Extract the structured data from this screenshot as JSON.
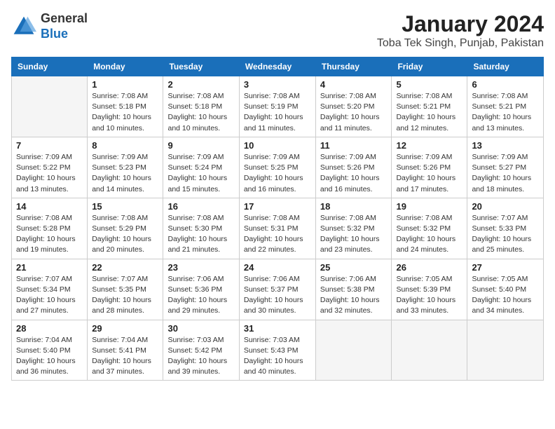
{
  "header": {
    "logo_line1": "General",
    "logo_line2": "Blue",
    "month_title": "January 2024",
    "location": "Toba Tek Singh, Punjab, Pakistan"
  },
  "weekdays": [
    "Sunday",
    "Monday",
    "Tuesday",
    "Wednesday",
    "Thursday",
    "Friday",
    "Saturday"
  ],
  "weeks": [
    [
      {
        "day": "",
        "info": ""
      },
      {
        "day": "1",
        "info": "Sunrise: 7:08 AM\nSunset: 5:18 PM\nDaylight: 10 hours\nand 10 minutes."
      },
      {
        "day": "2",
        "info": "Sunrise: 7:08 AM\nSunset: 5:18 PM\nDaylight: 10 hours\nand 10 minutes."
      },
      {
        "day": "3",
        "info": "Sunrise: 7:08 AM\nSunset: 5:19 PM\nDaylight: 10 hours\nand 11 minutes."
      },
      {
        "day": "4",
        "info": "Sunrise: 7:08 AM\nSunset: 5:20 PM\nDaylight: 10 hours\nand 11 minutes."
      },
      {
        "day": "5",
        "info": "Sunrise: 7:08 AM\nSunset: 5:21 PM\nDaylight: 10 hours\nand 12 minutes."
      },
      {
        "day": "6",
        "info": "Sunrise: 7:08 AM\nSunset: 5:21 PM\nDaylight: 10 hours\nand 13 minutes."
      }
    ],
    [
      {
        "day": "7",
        "info": ""
      },
      {
        "day": "8",
        "info": "Sunrise: 7:09 AM\nSunset: 5:23 PM\nDaylight: 10 hours\nand 14 minutes."
      },
      {
        "day": "9",
        "info": "Sunrise: 7:09 AM\nSunset: 5:24 PM\nDaylight: 10 hours\nand 15 minutes."
      },
      {
        "day": "10",
        "info": "Sunrise: 7:09 AM\nSunset: 5:25 PM\nDaylight: 10 hours\nand 16 minutes."
      },
      {
        "day": "11",
        "info": "Sunrise: 7:09 AM\nSunset: 5:26 PM\nDaylight: 10 hours\nand 16 minutes."
      },
      {
        "day": "12",
        "info": "Sunrise: 7:09 AM\nSunset: 5:26 PM\nDaylight: 10 hours\nand 17 minutes."
      },
      {
        "day": "13",
        "info": "Sunrise: 7:09 AM\nSunset: 5:27 PM\nDaylight: 10 hours\nand 18 minutes."
      }
    ],
    [
      {
        "day": "14",
        "info": ""
      },
      {
        "day": "15",
        "info": "Sunrise: 7:08 AM\nSunset: 5:29 PM\nDaylight: 10 hours\nand 20 minutes."
      },
      {
        "day": "16",
        "info": "Sunrise: 7:08 AM\nSunset: 5:30 PM\nDaylight: 10 hours\nand 21 minutes."
      },
      {
        "day": "17",
        "info": "Sunrise: 7:08 AM\nSunset: 5:31 PM\nDaylight: 10 hours\nand 22 minutes."
      },
      {
        "day": "18",
        "info": "Sunrise: 7:08 AM\nSunset: 5:32 PM\nDaylight: 10 hours\nand 23 minutes."
      },
      {
        "day": "19",
        "info": "Sunrise: 7:08 AM\nSunset: 5:32 PM\nDaylight: 10 hours\nand 24 minutes."
      },
      {
        "day": "20",
        "info": "Sunrise: 7:07 AM\nSunset: 5:33 PM\nDaylight: 10 hours\nand 25 minutes."
      }
    ],
    [
      {
        "day": "21",
        "info": ""
      },
      {
        "day": "22",
        "info": "Sunrise: 7:07 AM\nSunset: 5:35 PM\nDaylight: 10 hours\nand 28 minutes."
      },
      {
        "day": "23",
        "info": "Sunrise: 7:06 AM\nSunset: 5:36 PM\nDaylight: 10 hours\nand 29 minutes."
      },
      {
        "day": "24",
        "info": "Sunrise: 7:06 AM\nSunset: 5:37 PM\nDaylight: 10 hours\nand 30 minutes."
      },
      {
        "day": "25",
        "info": "Sunrise: 7:06 AM\nSunset: 5:38 PM\nDaylight: 10 hours\nand 32 minutes."
      },
      {
        "day": "26",
        "info": "Sunrise: 7:05 AM\nSunset: 5:39 PM\nDaylight: 10 hours\nand 33 minutes."
      },
      {
        "day": "27",
        "info": "Sunrise: 7:05 AM\nSunset: 5:40 PM\nDaylight: 10 hours\nand 34 minutes."
      }
    ],
    [
      {
        "day": "28",
        "info": "Sunrise: 7:04 AM\nSunset: 5:40 PM\nDaylight: 10 hours\nand 36 minutes."
      },
      {
        "day": "29",
        "info": "Sunrise: 7:04 AM\nSunset: 5:41 PM\nDaylight: 10 hours\nand 37 minutes."
      },
      {
        "day": "30",
        "info": "Sunrise: 7:03 AM\nSunset: 5:42 PM\nDaylight: 10 hours\nand 39 minutes."
      },
      {
        "day": "31",
        "info": "Sunrise: 7:03 AM\nSunset: 5:43 PM\nDaylight: 10 hours\nand 40 minutes."
      },
      {
        "day": "",
        "info": ""
      },
      {
        "day": "",
        "info": ""
      },
      {
        "day": "",
        "info": ""
      }
    ]
  ],
  "week1_sun_info": "Sunrise: 7:09 AM\nSunset: 5:22 PM\nDaylight: 10 hours\nand 13 minutes.",
  "week3_sun_info": "Sunrise: 7:08 AM\nSunset: 5:28 PM\nDaylight: 10 hours\nand 19 minutes.",
  "week4_sun_info": "Sunrise: 7:07 AM\nSunset: 5:34 PM\nDaylight: 10 hours\nand 27 minutes."
}
